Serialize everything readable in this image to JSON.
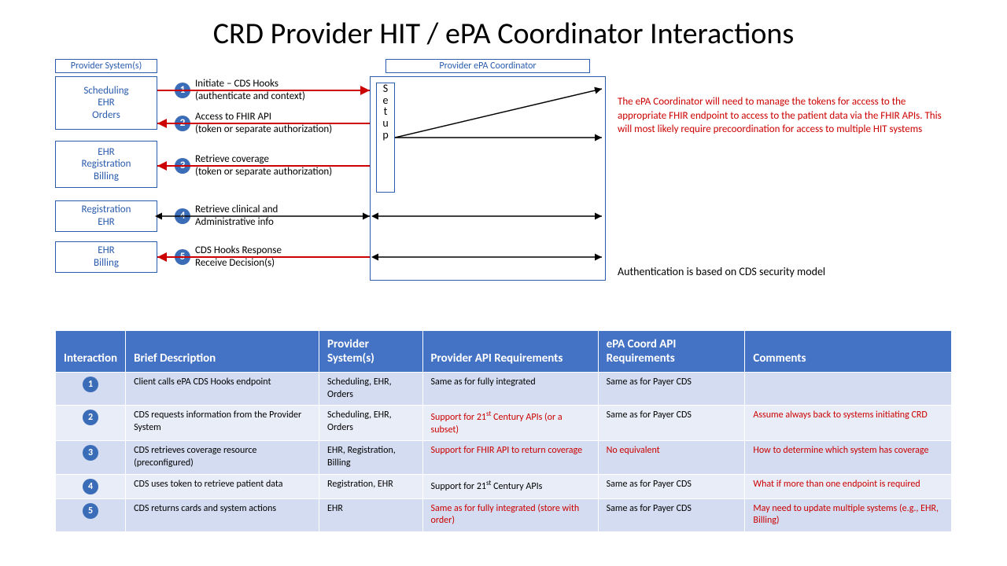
{
  "title": "CRD Provider HIT / ePA Coordinator Interactions",
  "diagram": {
    "provider_systems_label": "Provider System(s)",
    "epa_label": "Provider ePA Coordinator",
    "setup_label": "Setup",
    "boxes": {
      "scheduling": "Scheduling\nEHR\nOrders",
      "ehr_reg_billing": "EHR\nRegistration\nBilling",
      "registration_ehr": "Registration\nEHR",
      "ehr_billing": "EHR\nBilling"
    },
    "steps": [
      {
        "n": "1",
        "line1": "Initiate – CDS Hooks",
        "line2": "(authenticate and context)"
      },
      {
        "n": "2",
        "line1": "Access to FHIR API",
        "line2": "(token or separate authorization)"
      },
      {
        "n": "3",
        "line1": "Retrieve coverage",
        "line2": "(token or separate authorization)"
      },
      {
        "n": "4",
        "line1": "Retrieve clinical and",
        "line2": "Administrative info"
      },
      {
        "n": "5",
        "line1": "CDS Hooks Response",
        "line2": "Receive Decision(s)"
      }
    ],
    "red_note": "The ePA Coordinator will need to manage the tokens for access to  the appropriate FHIR endpoint  to access to the patient data via the FHIR APIs.  This will most likely require precoordination for access to multiple HIT systems",
    "auth_note": "Authentication is based on CDS security model"
  },
  "table": {
    "headers": [
      "Interaction",
      "Brief Description",
      "Provider System(s)",
      "Provider API Requirements",
      "ePA Coord API Requirements",
      "Comments"
    ],
    "rows": [
      {
        "n": "1",
        "desc": "Client calls ePA CDS Hooks endpoint",
        "ps": "Scheduling, EHR, Orders",
        "papi": "Same as for fully integrated",
        "papi_red": false,
        "eapi": "Same as for Payer CDS",
        "eapi_red": false,
        "comm": "",
        "comm_red": false
      },
      {
        "n": "2",
        "desc": "CDS requests information from the Provider System",
        "ps": "Scheduling, EHR, Orders",
        "papi": "Support for 21st Century APIs (or a subset)",
        "papi_red": true,
        "papi_sup": true,
        "eapi": "Same as for Payer CDS",
        "eapi_red": false,
        "comm": "Assume always back to systems initiating CRD",
        "comm_red": true
      },
      {
        "n": "3",
        "desc": "CDS retrieves coverage resource (preconfigured)",
        "ps": "EHR, Registration, Billing",
        "papi": "Support for FHIR API to return coverage",
        "papi_red": true,
        "eapi": "No equivalent",
        "eapi_red": true,
        "comm": "How to determine which system has coverage",
        "comm_red": true
      },
      {
        "n": "4",
        "desc": "CDS uses token to retrieve patient data",
        "ps": "Registration, EHR",
        "papi": "Support for 21st Century APIs",
        "papi_red": false,
        "papi_sup": true,
        "eapi": "Same as for Payer CDS",
        "eapi_red": false,
        "comm": "What if more than one endpoint is required",
        "comm_red": true
      },
      {
        "n": "5",
        "desc": "CDS returns cards and system actions",
        "ps": "EHR",
        "papi": "Same as for fully integrated (store with order)",
        "papi_red": true,
        "eapi": "Same as for Payer CDS",
        "eapi_red": false,
        "comm": "May need to update multiple systems (e.g., EHR, Billing)",
        "comm_red": true
      }
    ]
  },
  "chart_data": {
    "type": "table",
    "title": "CRD Provider HIT / ePA Coordinator Interactions",
    "columns": [
      "Interaction",
      "Brief Description",
      "Provider System(s)",
      "Provider API Requirements",
      "ePA Coord API Requirements",
      "Comments"
    ],
    "rows": [
      [
        "1",
        "Client calls ePA CDS Hooks endpoint",
        "Scheduling, EHR, Orders",
        "Same as for fully integrated",
        "Same as for Payer CDS",
        ""
      ],
      [
        "2",
        "CDS requests information from the Provider System",
        "Scheduling, EHR, Orders",
        "Support for 21st Century APIs (or a subset)",
        "Same as for Payer CDS",
        "Assume always back to systems initiating CRD"
      ],
      [
        "3",
        "CDS retrieves coverage resource (preconfigured)",
        "EHR, Registration, Billing",
        "Support for FHIR API to return coverage",
        "No equivalent",
        "How to determine which system has coverage"
      ],
      [
        "4",
        "CDS uses token to retrieve patient data",
        "Registration, EHR",
        "Support for 21st Century APIs",
        "Same as for Payer CDS",
        "What if more than one endpoint is required"
      ],
      [
        "5",
        "CDS returns cards and system actions",
        "EHR",
        "Same as for fully integrated (store with order)",
        "Same as for Payer CDS",
        "May need to update multiple systems (e.g., EHR, Billing)"
      ]
    ]
  }
}
